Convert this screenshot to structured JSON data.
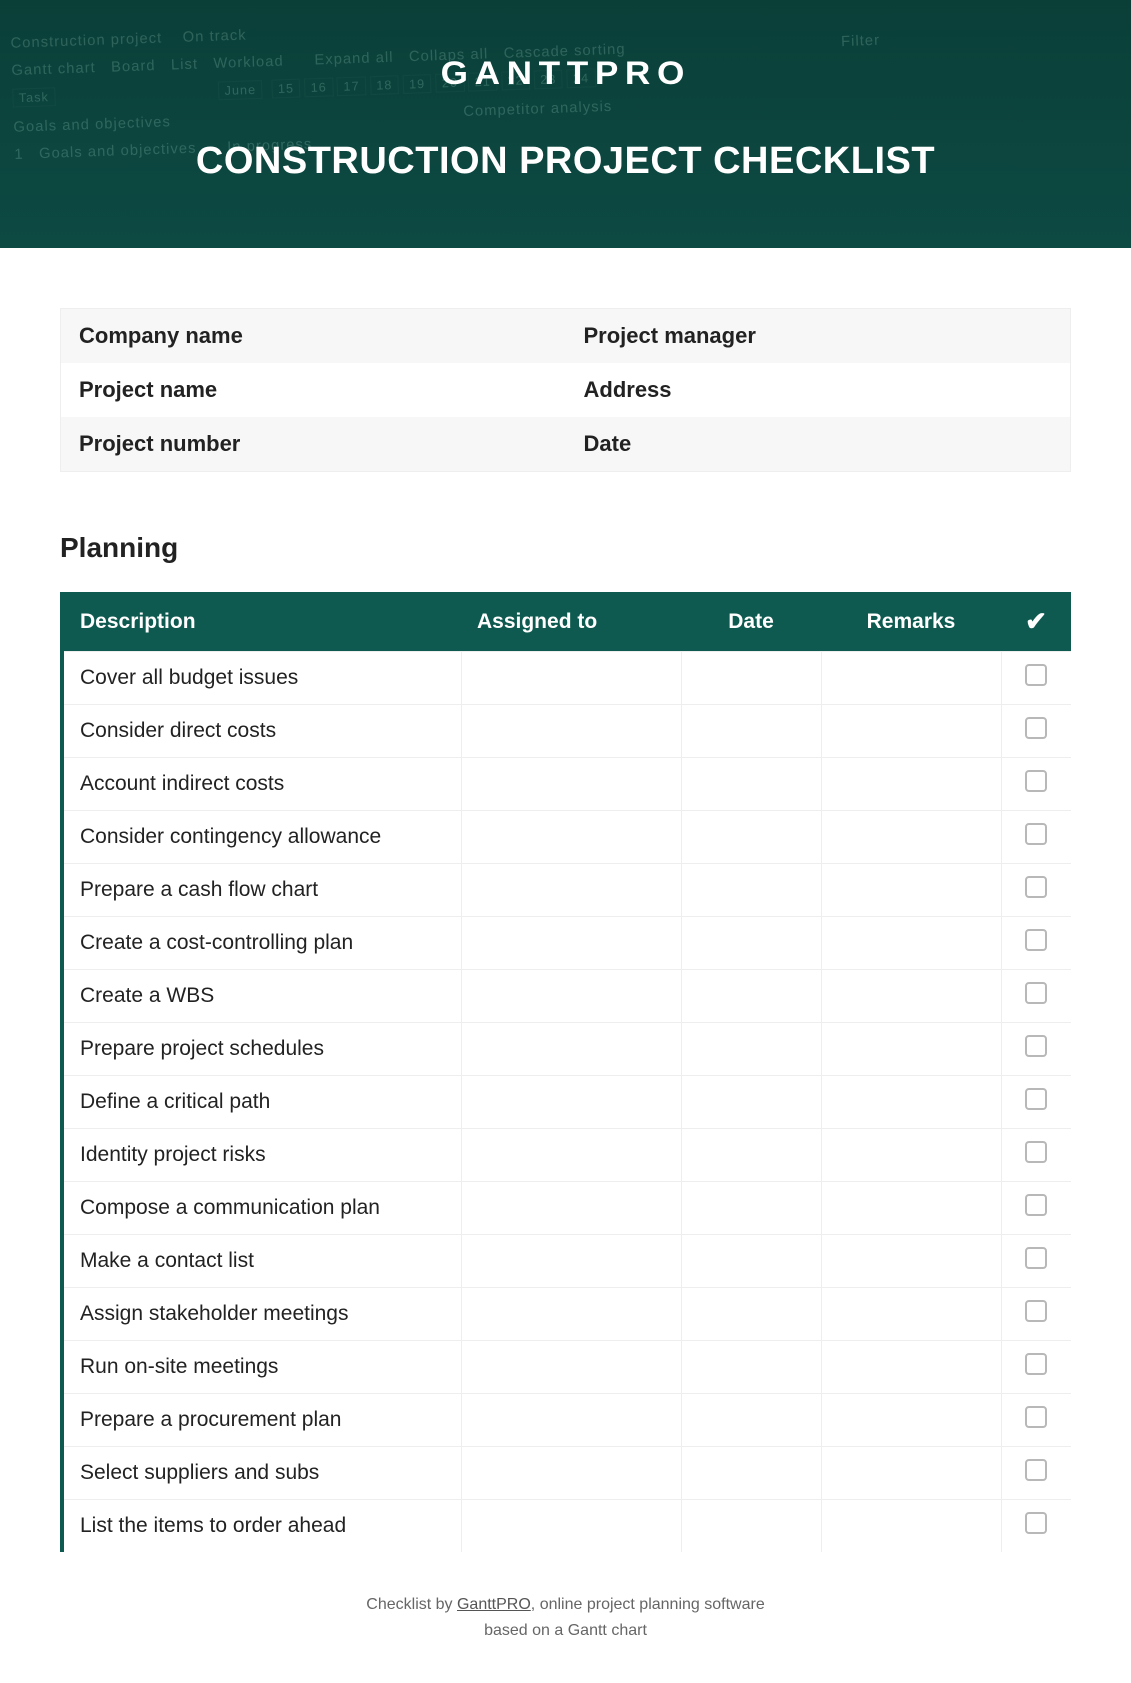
{
  "brand": "GANTTPRO",
  "hero_title": "CONSTRUCTION PROJECT CHECKLIST",
  "colors": {
    "accent": "#0e5a50"
  },
  "info": {
    "rows": [
      {
        "left": "Company name",
        "right": "Project manager"
      },
      {
        "left": "Project name",
        "right": "Address"
      },
      {
        "left": "Project number",
        "right": "Date"
      }
    ]
  },
  "section": "Planning",
  "columns": {
    "description": "Description",
    "assigned": "Assigned to",
    "date": "Date",
    "remarks": "Remarks",
    "check": "✔"
  },
  "items": [
    {
      "description": "Cover all budget issues",
      "assigned": "",
      "date": "",
      "remarks": "",
      "checked": false
    },
    {
      "description": "Consider direct costs",
      "assigned": "",
      "date": "",
      "remarks": "",
      "checked": false
    },
    {
      "description": "Account indirect costs",
      "assigned": "",
      "date": "",
      "remarks": "",
      "checked": false
    },
    {
      "description": "Consider contingency allowance",
      "assigned": "",
      "date": "",
      "remarks": "",
      "checked": false
    },
    {
      "description": "Prepare a cash flow chart",
      "assigned": "",
      "date": "",
      "remarks": "",
      "checked": false
    },
    {
      "description": "Create a cost-controlling plan",
      "assigned": "",
      "date": "",
      "remarks": "",
      "checked": false
    },
    {
      "description": "Create a WBS",
      "assigned": "",
      "date": "",
      "remarks": "",
      "checked": false
    },
    {
      "description": "Prepare project schedules",
      "assigned": "",
      "date": "",
      "remarks": "",
      "checked": false
    },
    {
      "description": "Define a critical path",
      "assigned": "",
      "date": "",
      "remarks": "",
      "checked": false
    },
    {
      "description": "Identity project risks",
      "assigned": "",
      "date": "",
      "remarks": "",
      "checked": false
    },
    {
      "description": "Compose a communication plan",
      "assigned": "",
      "date": "",
      "remarks": "",
      "checked": false
    },
    {
      "description": "Make a contact list",
      "assigned": "",
      "date": "",
      "remarks": "",
      "checked": false
    },
    {
      "description": "Assign stakeholder meetings",
      "assigned": "",
      "date": "",
      "remarks": "",
      "checked": false
    },
    {
      "description": "Run on-site meetings",
      "assigned": "",
      "date": "",
      "remarks": "",
      "checked": false
    },
    {
      "description": "Prepare a procurement plan",
      "assigned": "",
      "date": "",
      "remarks": "",
      "checked": false
    },
    {
      "description": "Select suppliers and subs",
      "assigned": "",
      "date": "",
      "remarks": "",
      "checked": false
    },
    {
      "description": "List the items to order ahead",
      "assigned": "",
      "date": "",
      "remarks": "",
      "checked": false
    }
  ],
  "footer": {
    "line1_pre": "Checklist by ",
    "line1_link": "GanttPRO",
    "line1_post": ", online project planning software",
    "line2": "based on a Gantt chart"
  },
  "bg_hints": {
    "project": "Construction project",
    "status": "On track",
    "tabs": [
      "Gantt chart",
      "Board",
      "List",
      "Workload"
    ],
    "controls": [
      "Expand all",
      "Collaps all",
      "Cascade sorting"
    ],
    "filter": "Filter",
    "month": "June",
    "days": [
      "15",
      "16",
      "17",
      "18",
      "19",
      "20",
      "21",
      "22",
      "23",
      "24"
    ],
    "task_header": "Task",
    "group": "Goals and objectives",
    "itemstate": "In progress",
    "rightnote": "Competitor analysis"
  }
}
